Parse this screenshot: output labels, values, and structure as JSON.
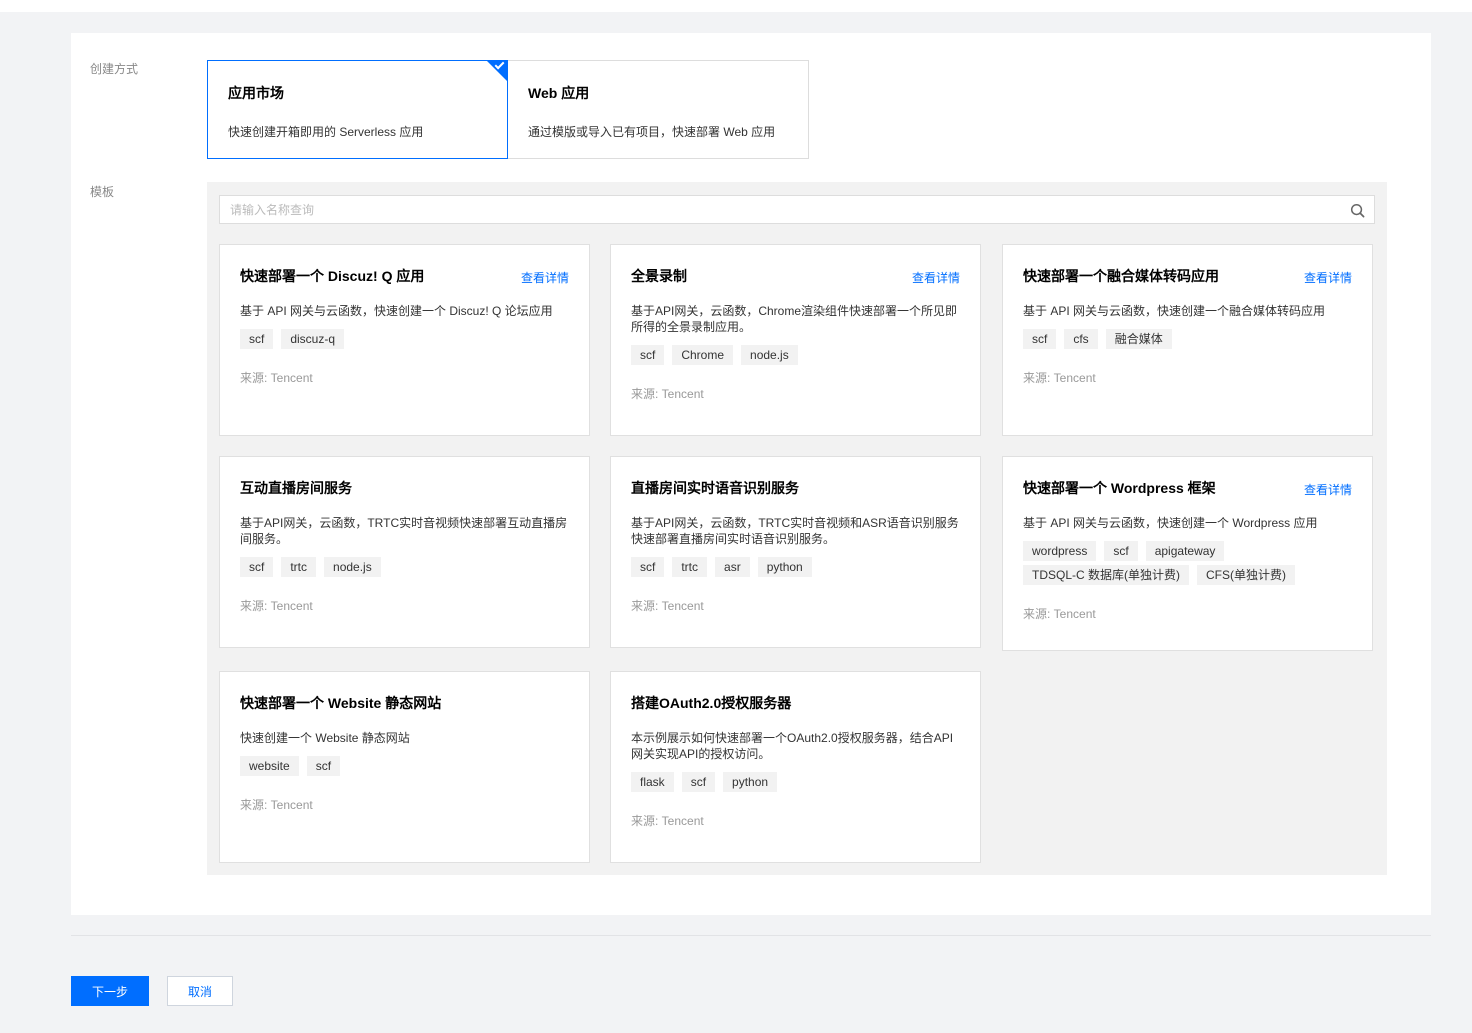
{
  "form": {
    "creation_method_label": "创建方式",
    "template_label": "模板",
    "methods": [
      {
        "title": "应用市场",
        "desc": "快速创建开箱即用的 Serverless 应用",
        "selected": true
      },
      {
        "title": "Web 应用",
        "desc": "通过模版或导入已有项目，快速部署 Web 应用",
        "selected": false
      }
    ]
  },
  "search": {
    "placeholder": "请输入名称查询",
    "value": ""
  },
  "templates": [
    {
      "title": "快速部署一个 Discuz! Q 应用",
      "detail": "查看详情",
      "desc": "基于 API 网关与云函数，快速创建一个 Discuz! Q 论坛应用",
      "tags": [
        "scf",
        "discuz-q"
      ],
      "source": "来源: Tencent"
    },
    {
      "title": "全景录制",
      "detail": "查看详情",
      "desc": "基于API网关，云函数，Chrome渲染组件快速部署一个所见即所得的全景录制应用。",
      "tags": [
        "scf",
        "Chrome",
        "node.js"
      ],
      "source": "来源: Tencent"
    },
    {
      "title": "快速部署一个融合媒体转码应用",
      "detail": "查看详情",
      "desc": "基于 API 网关与云函数，快速创建一个融合媒体转码应用",
      "tags": [
        "scf",
        "cfs",
        "融合媒体"
      ],
      "source": "来源: Tencent"
    },
    {
      "title": "互动直播房间服务",
      "detail": "",
      "desc": "基于API网关，云函数，TRTC实时音视频快速部署互动直播房间服务。",
      "tags": [
        "scf",
        "trtc",
        "node.js"
      ],
      "source": "来源: Tencent"
    },
    {
      "title": "直播房间实时语音识别服务",
      "detail": "",
      "desc": "基于API网关，云函数，TRTC实时音视频和ASR语音识别服务快速部署直播房间实时语音识别服务。",
      "tags": [
        "scf",
        "trtc",
        "asr",
        "python"
      ],
      "source": "来源: Tencent"
    },
    {
      "title": "快速部署一个 Wordpress 框架",
      "detail": "查看详情",
      "desc": "基于 API 网关与云函数，快速创建一个 Wordpress 应用",
      "tags": [
        "wordpress",
        "scf",
        "apigateway",
        "TDSQL-C 数据库(单独计费)",
        "CFS(单独计费)"
      ],
      "source": "来源: Tencent"
    },
    {
      "title": "快速部署一个 Website 静态网站",
      "detail": "",
      "desc": "快速创建一个 Website 静态网站",
      "tags": [
        "website",
        "scf"
      ],
      "source": "来源: Tencent"
    },
    {
      "title": "搭建OAuth2.0授权服务器",
      "detail": "",
      "desc": "本示例展示如何快速部署一个OAuth2.0授权服务器，结合API网关实现API的授权访问。",
      "tags": [
        "flask",
        "scf",
        "python"
      ],
      "source": "来源: Tencent"
    }
  ],
  "footer": {
    "next_label": "下一步",
    "cancel_label": "取消"
  },
  "colors": {
    "accent": "#006eff",
    "page_bg": "#f2f3f5",
    "template_bg": "#f2f2f2"
  }
}
